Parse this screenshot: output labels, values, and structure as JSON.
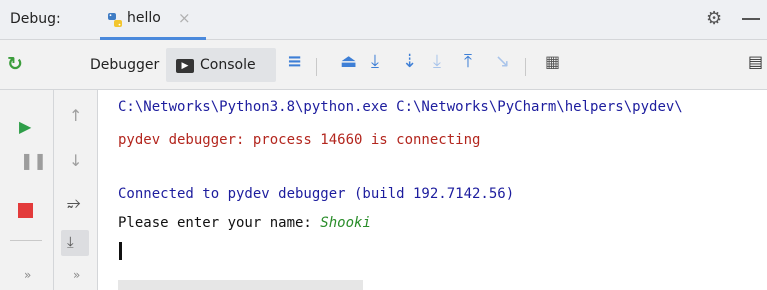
{
  "titlebar": {
    "label": "Debug:",
    "tab": {
      "label": "hello",
      "close": "×"
    },
    "settings_icon": "gear-icon",
    "minimize_icon": "minimize-icon"
  },
  "toolbar": {
    "tabs": [
      {
        "label": "Debugger"
      },
      {
        "label": "Console",
        "active": true
      }
    ],
    "icons": [
      "menu-icon",
      "show-execution-point-icon",
      "step-over-icon",
      "step-into-icon",
      "step-into-my-code-icon",
      "step-out-icon",
      "run-to-cursor-icon",
      "evaluate-expression-icon",
      "layout-icon"
    ]
  },
  "sidebar": {
    "buttons": [
      "rerun-icon",
      "resume-icon",
      "pause-icon",
      "stop-icon",
      "more-icon"
    ],
    "more": "»"
  },
  "gutter": {
    "buttons": [
      "scroll-up-icon",
      "scroll-down-icon",
      "soft-wrap-icon",
      "scroll-to-end-icon",
      "more-icon"
    ],
    "more": "»"
  },
  "console": {
    "lines": [
      "C:\\Networks\\Python3.8\\python.exe C:\\Networks\\PyCharm\\helpers\\pydev\\",
      "pydev debugger: process 14660 is connecting",
      "Connected to pydev debugger (build 192.7142.56)"
    ],
    "prompt": "Please enter your name: ",
    "input_value": "Shooki"
  },
  "colors": {
    "accent": "#4a89dc",
    "command_text": "#1d1d9e",
    "error_text": "#b3261e",
    "input_text": "#2a8d2a",
    "stop": "#e33b3b",
    "resume": "#2f9e49"
  }
}
